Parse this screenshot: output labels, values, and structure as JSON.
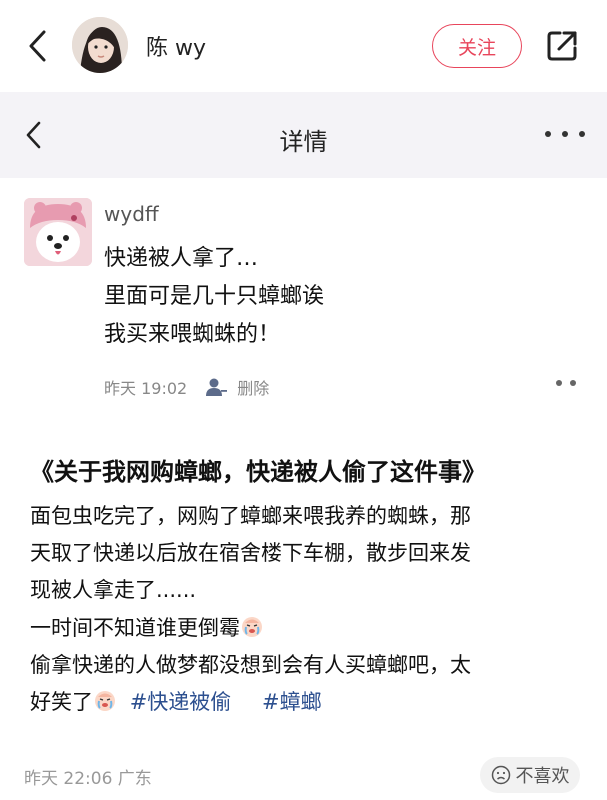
{
  "header": {
    "author_name": "陈 wy",
    "follow_label": "关注"
  },
  "detail": {
    "title": "详情"
  },
  "comment": {
    "username": "wydff",
    "lines": [
      "快递被人拿了…",
      "里面可是几十只蟑螂诶",
      "我买来喂蜘蛛的！"
    ],
    "time": "昨天 19:02",
    "delete_label": "删除"
  },
  "post": {
    "title": "《关于我网购蟑螂，快递被人偷了这件事》",
    "line1": "面包虫吃完了，网购了蟑螂来喂我养的蜘蛛，那",
    "line2": "天取了快递以后放在宿舍楼下车棚，散步回来发",
    "line3": "现被人拿走了......",
    "line4": "一时间不知道谁更倒霉",
    "line5": "偷拿快递的人做梦都没想到会有人买蟑螂吧，太",
    "line6": "好笑了",
    "hashtags": [
      "#快递被偷",
      "#蟑螂"
    ]
  },
  "footer": {
    "meta": "昨天 22:06 广东",
    "dislike_label": "不喜欢"
  },
  "colors": {
    "accent": "#e8455b",
    "hashtag": "#2c4f8f",
    "header_bg": "#f4f3f7"
  }
}
